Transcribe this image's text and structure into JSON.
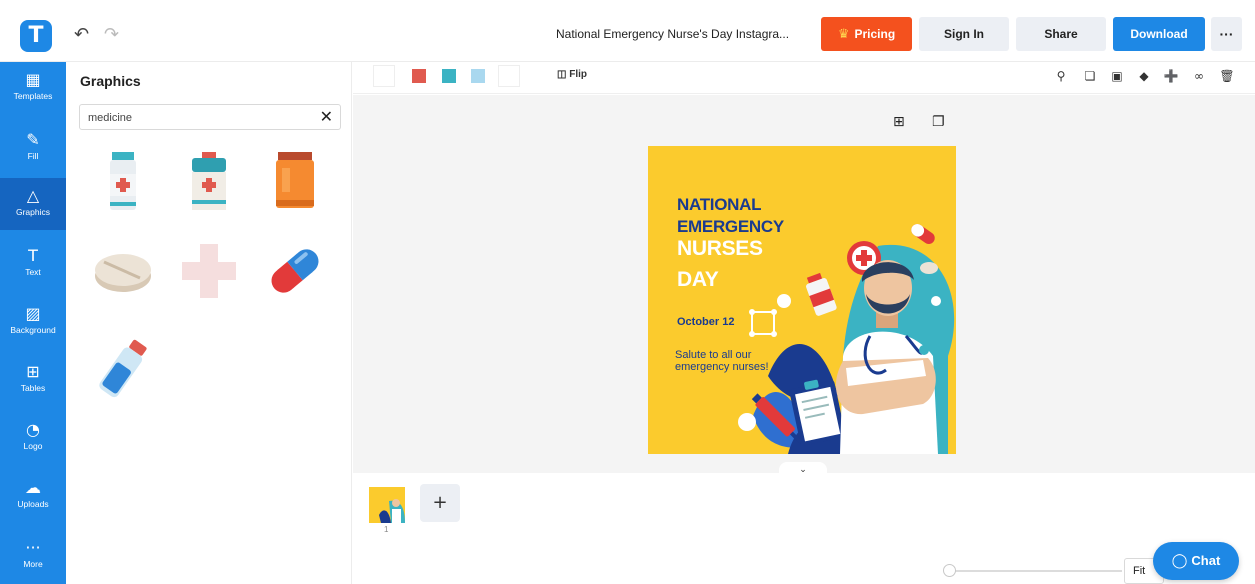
{
  "app": {
    "logo_letter": "T"
  },
  "header": {
    "undo_icon": "undo-icon",
    "redo_icon": "redo-icon",
    "doc_title": "National Emergency Nurse's Day Instagra...",
    "pricing_label": "Pricing",
    "signin_label": "Sign In",
    "share_label": "Share",
    "download_label": "Download",
    "more_label": "···"
  },
  "sidebar": {
    "items": [
      {
        "label": "Templates",
        "icon": "▦"
      },
      {
        "label": "Fill",
        "icon": "✎"
      },
      {
        "label": "Graphics",
        "icon": "△"
      },
      {
        "label": "Text",
        "icon": "T"
      },
      {
        "label": "Background",
        "icon": "▨"
      },
      {
        "label": "Tables",
        "icon": "⊞"
      },
      {
        "label": "Logo",
        "icon": "◔"
      },
      {
        "label": "Uploads",
        "icon": "☁"
      },
      {
        "label": "More",
        "icon": "···"
      }
    ],
    "active": "Graphics"
  },
  "panel": {
    "title": "Graphics",
    "search_value": "medicine",
    "clear_icon": "✕"
  },
  "toolbar": {
    "flip_label": "Flip",
    "swatches": [
      "#ffffff",
      "#e05a4f",
      "#3bb3c3",
      "#a9d8ef",
      "#ffffff"
    ]
  },
  "design": {
    "title_line1": "NATIONAL",
    "title_line2": "EMERGENCY",
    "title_line3": "NURSES",
    "title_line4": "DAY",
    "date": "October 12",
    "message": "Salute to all our emergency nurses!",
    "colors": {
      "background": "#fbcb2d",
      "navy": "#1a3b8f",
      "teal": "#3bb3c3"
    }
  },
  "pages": {
    "current_page": "1",
    "add_label": "+"
  },
  "zoom": {
    "fit_label": "Fit"
  },
  "chat": {
    "label": "Chat"
  }
}
